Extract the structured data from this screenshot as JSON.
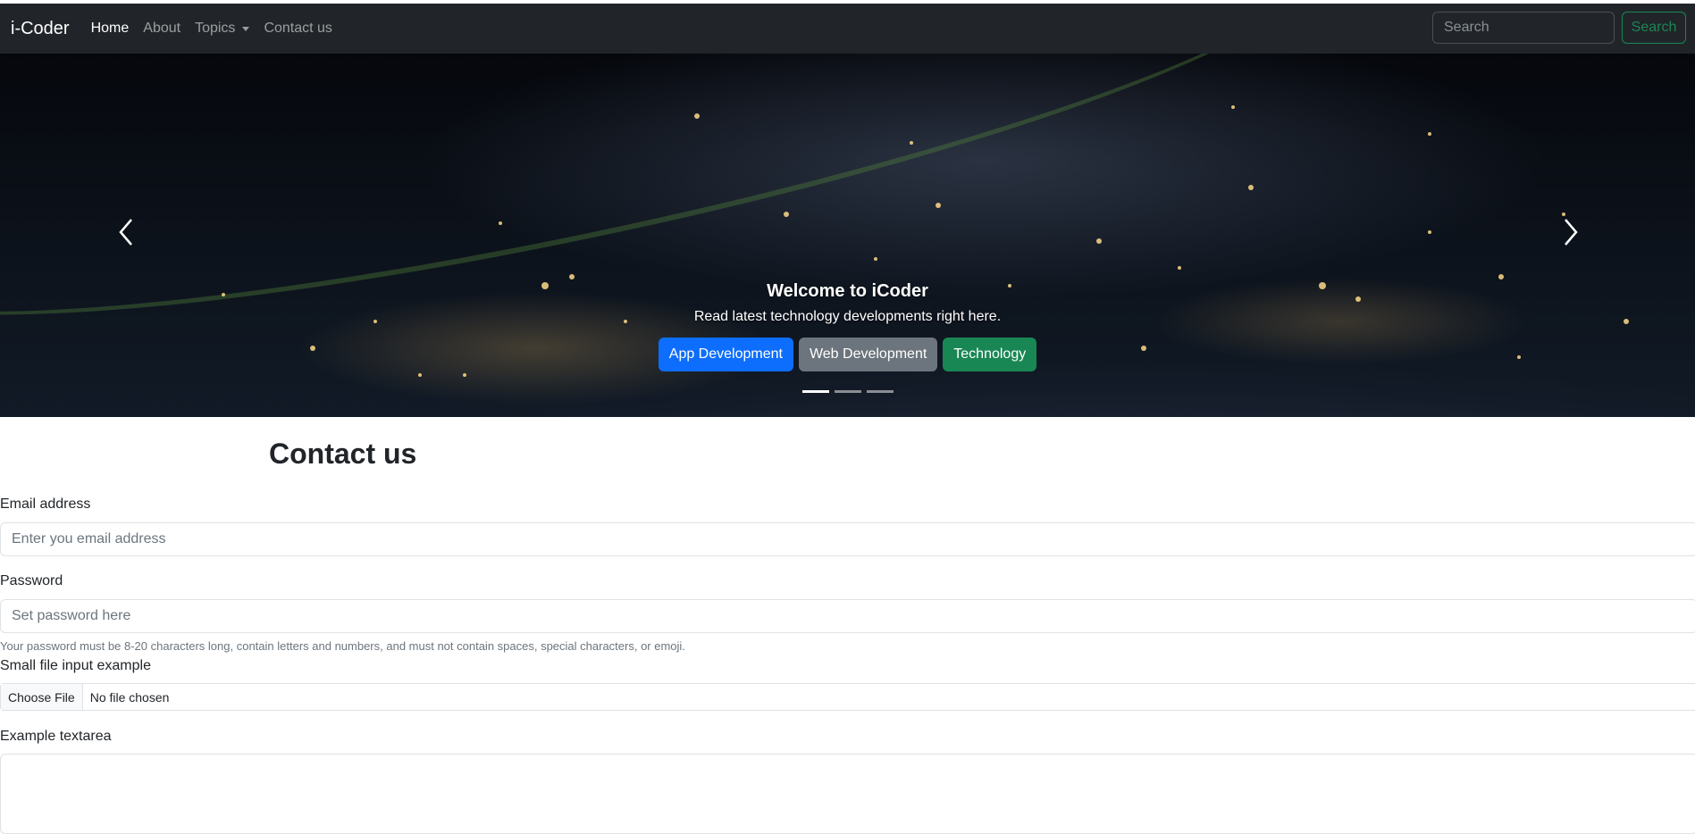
{
  "navbar": {
    "brand": "i-Coder",
    "links": [
      {
        "label": "Home",
        "active": true
      },
      {
        "label": "About",
        "active": false
      },
      {
        "label": "Topics",
        "active": false
      },
      {
        "label": "Contact us",
        "active": false
      }
    ],
    "search_placeholder": "Search",
    "search_button": "Search"
  },
  "carousel": {
    "caption_title": "Welcome to iCoder",
    "caption_text": "Read latest technology developments right here.",
    "buttons": [
      {
        "label": "App Development",
        "color": "#0d6efd"
      },
      {
        "label": "Web Development",
        "color": "#6c757d"
      },
      {
        "label": "Technology",
        "color": "#198754"
      }
    ],
    "active_slide": 1,
    "slide_count": 3
  },
  "contact": {
    "title": "Contact us",
    "email_label": "Email address",
    "email_placeholder": "Enter you email address",
    "password_label": "Password",
    "password_placeholder": "Set password here",
    "password_help": "Your password must be 8-20 characters long, contain letters and numbers, and must not contain spaces, special characters, or emoji.",
    "file_label": "Small file input example",
    "file_button": "Choose File",
    "file_status": "No file chosen",
    "textarea_label": "Example textarea"
  }
}
